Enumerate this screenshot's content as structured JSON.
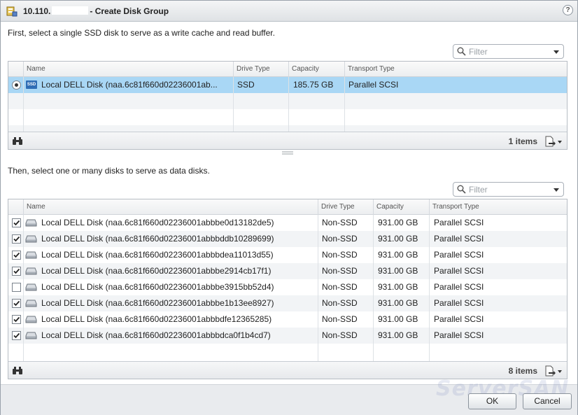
{
  "dialog": {
    "title_ip": "10.110.",
    "title_suffix": "- Create Disk Group",
    "help_label": "?"
  },
  "ssd_section": {
    "instruction": "First, select a single SSD disk to serve as a write cache and read buffer.",
    "filter_placeholder": "Filter",
    "columns": [
      "Name",
      "Drive Type",
      "Capacity",
      "Transport Type"
    ],
    "rows": [
      {
        "selected": true,
        "badge": "SSD",
        "name": "Local DELL Disk (naa.6c81f660d02236001ab...",
        "drive_type": "SSD",
        "capacity": "185.75 GB",
        "transport": "Parallel SCSI"
      }
    ],
    "item_count": "1 items"
  },
  "data_section": {
    "instruction": "Then, select one or many disks to serve as data disks.",
    "filter_placeholder": "Filter",
    "columns": [
      "Name",
      "Drive Type",
      "Capacity",
      "Transport Type"
    ],
    "rows": [
      {
        "checked": true,
        "name": "Local DELL Disk (naa.6c81f660d02236001abbbe0d13182de5)",
        "drive_type": "Non-SSD",
        "capacity": "931.00 GB",
        "transport": "Parallel SCSI"
      },
      {
        "checked": true,
        "name": "Local DELL Disk (naa.6c81f660d02236001abbbddb10289699)",
        "drive_type": "Non-SSD",
        "capacity": "931.00 GB",
        "transport": "Parallel SCSI"
      },
      {
        "checked": true,
        "name": "Local DELL Disk (naa.6c81f660d02236001abbbdea11013d55)",
        "drive_type": "Non-SSD",
        "capacity": "931.00 GB",
        "transport": "Parallel SCSI"
      },
      {
        "checked": true,
        "name": "Local DELL Disk (naa.6c81f660d02236001abbbe2914cb17f1)",
        "drive_type": "Non-SSD",
        "capacity": "931.00 GB",
        "transport": "Parallel SCSI"
      },
      {
        "checked": false,
        "name": "Local DELL Disk (naa.6c81f660d02236001abbbe3915bb52d4)",
        "drive_type": "Non-SSD",
        "capacity": "931.00 GB",
        "transport": "Parallel SCSI"
      },
      {
        "checked": true,
        "name": "Local DELL Disk (naa.6c81f660d02236001abbbe1b13ee8927)",
        "drive_type": "Non-SSD",
        "capacity": "931.00 GB",
        "transport": "Parallel SCSI"
      },
      {
        "checked": true,
        "name": "Local DELL Disk (naa.6c81f660d02236001abbbdfe12365285)",
        "drive_type": "Non-SSD",
        "capacity": "931.00 GB",
        "transport": "Parallel SCSI"
      },
      {
        "checked": true,
        "name": "Local DELL Disk (naa.6c81f660d02236001abbbdca0f1b4cd7)",
        "drive_type": "Non-SSD",
        "capacity": "931.00 GB",
        "transport": "Parallel SCSI"
      }
    ],
    "item_count": "8 items"
  },
  "buttons": {
    "ok": "OK",
    "cancel": "Cancel"
  },
  "watermark": "ServerSAN",
  "icons": {
    "title": "storage-policy-icon",
    "help": "help-icon",
    "filter": "search-icon",
    "find": "binoculars-icon",
    "export": "export-icon",
    "disk": "hard-disk-icon"
  }
}
